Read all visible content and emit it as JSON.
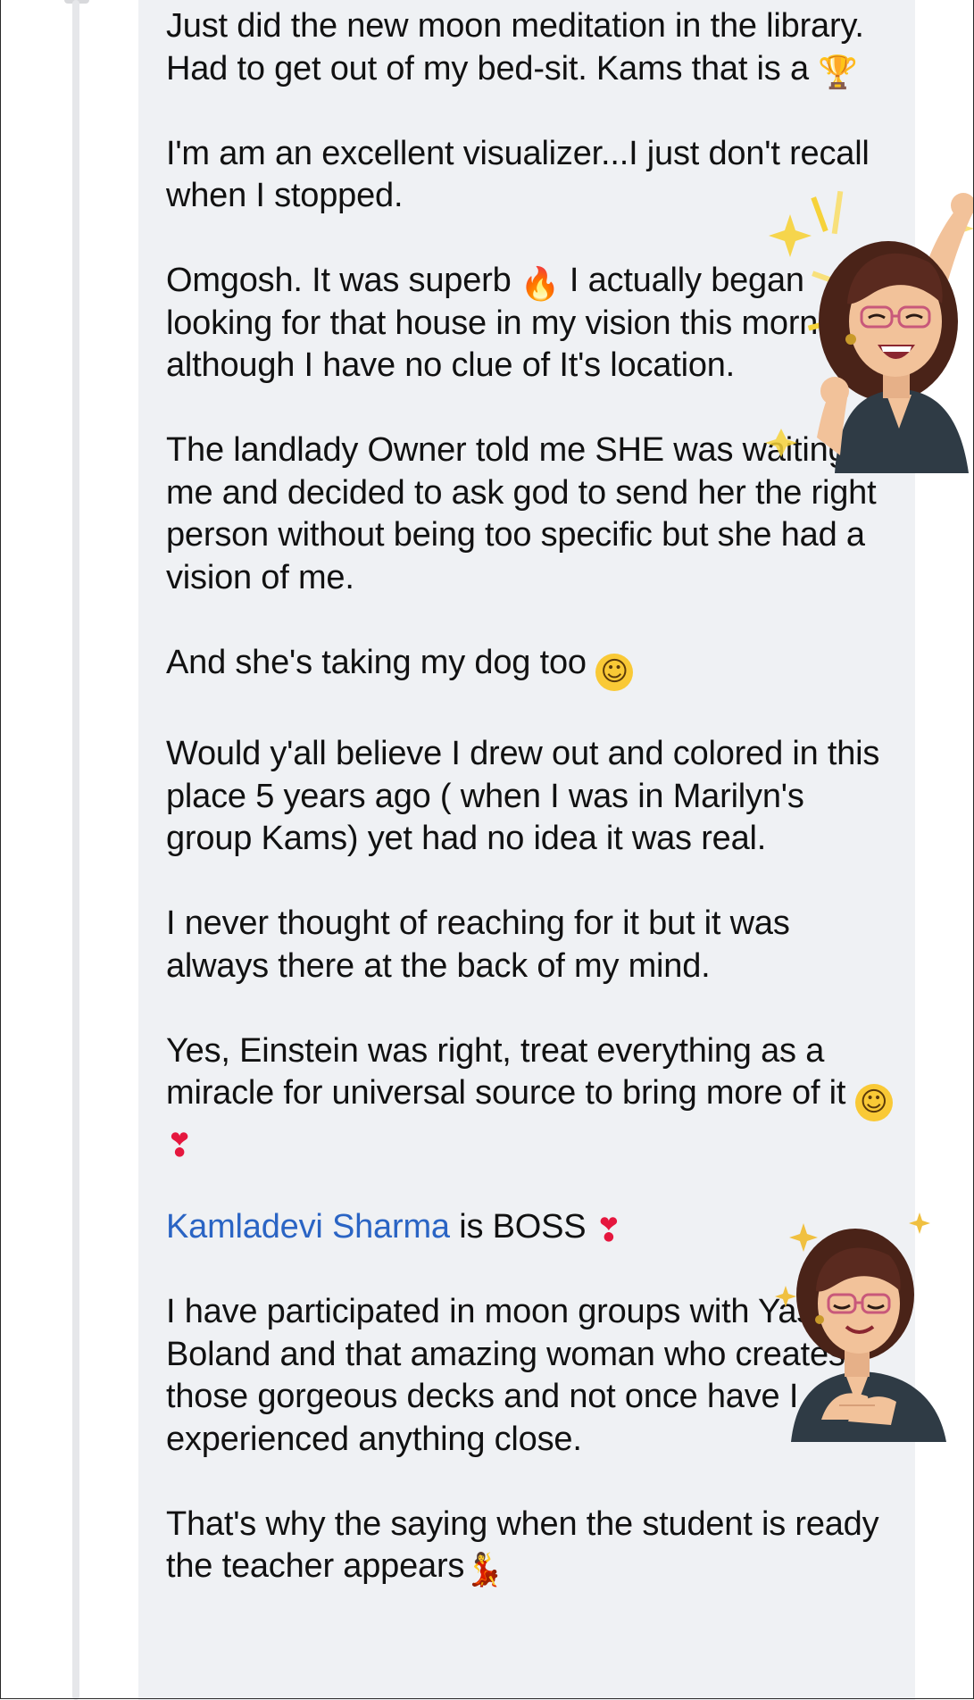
{
  "comment": {
    "paragraphs": [
      {
        "segments": [
          {
            "type": "text",
            "value": "Just did the new moon meditation in the library. Had to get out of my bed-sit. Kams that is a "
          },
          {
            "type": "emoji",
            "name": "trophy",
            "glyph": "🏆"
          }
        ]
      },
      {
        "segments": [
          {
            "type": "text",
            "value": " I'm am an excellent visualizer...I just don't recall when I stopped."
          }
        ]
      },
      {
        "segments": [
          {
            "type": "text",
            "value": "Omgosh. It was superb "
          },
          {
            "type": "emoji",
            "name": "fire",
            "glyph": "🔥"
          },
          {
            "type": "text",
            "value": " I actually began looking for that house in my vision this morning although I have no clue of It's location."
          }
        ]
      },
      {
        "segments": [
          {
            "type": "text",
            "value": "The landlady Owner told me SHE was waiting for me and decided to ask god to send her the right person without being too specific but she had a vision of me."
          }
        ]
      },
      {
        "segments": [
          {
            "type": "text",
            "value": "And she's taking my dog too "
          },
          {
            "type": "emoji",
            "name": "smile",
            "glyph": "☺"
          }
        ]
      },
      {
        "segments": [
          {
            "type": "text",
            "value": "Would y'all believe I drew out and colored in this place 5 years ago ( when I was in Marilyn's group Kams) yet had no idea it was real."
          }
        ]
      },
      {
        "segments": [
          {
            "type": "text",
            "value": "I never thought of reaching for it but it was always there at the back of my mind."
          }
        ]
      },
      {
        "segments": [
          {
            "type": "text",
            "value": "Yes, Einstein was right, treat everything as a miracle for universal source to bring more of it "
          },
          {
            "type": "emoji",
            "name": "grin",
            "glyph": "☺"
          },
          {
            "type": "text",
            "value": " "
          },
          {
            "type": "emoji",
            "name": "heart",
            "glyph": "❣"
          }
        ]
      },
      {
        "segments": [
          {
            "type": "mention",
            "value": "Kamladevi Sharma"
          },
          {
            "type": "text",
            "value": " is BOSS "
          },
          {
            "type": "emoji",
            "name": "heart",
            "glyph": "❣"
          }
        ]
      },
      {
        "segments": [
          {
            "type": "text",
            "value": " I have participated in moon groups with Yasmin Boland and that amazing woman who creates those gorgeous decks and not once have I experienced anything close."
          }
        ]
      },
      {
        "segments": [
          {
            "type": "text",
            "value": "That's why the saying when the student is ready the teacher appears"
          },
          {
            "type": "emoji",
            "name": "dancer",
            "glyph": "💃"
          }
        ]
      }
    ]
  },
  "stickers": [
    {
      "name": "avatar-celebrating-sticker",
      "skin": "#f2c29a",
      "hair": "#5a2a1f",
      "shirt": "#2f3b45",
      "sparkle": "#f6d23a"
    },
    {
      "name": "avatar-grateful-sticker",
      "skin": "#f2c29a",
      "hair": "#5a2a1f",
      "shirt": "#2f3b45",
      "sparkle": "#f0c040"
    }
  ],
  "colors": {
    "bubble": "#eff1f4",
    "text": "#111111",
    "mention": "#2a64c4",
    "thread_line": "#e6e7ea"
  }
}
